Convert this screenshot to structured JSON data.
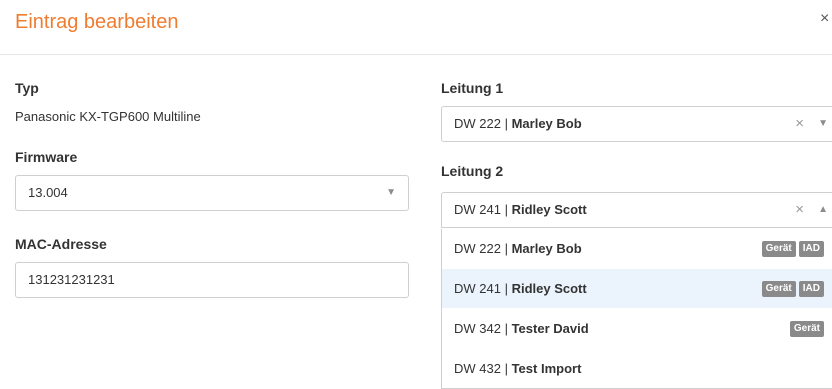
{
  "dialog": {
    "title": "Eintrag bearbeiten",
    "close": "×"
  },
  "left": {
    "typ_label": "Typ",
    "typ_value": "Panasonic KX-TGP600 Multiline",
    "firmware_label": "Firmware",
    "firmware_value": "13.004",
    "mac_label": "MAC-Adresse",
    "mac_value": "131231231231"
  },
  "right": {
    "leitung1_label": "Leitung 1",
    "leitung1": {
      "code": "DW 222",
      "name": "Marley Bob"
    },
    "leitung2_label": "Leitung 2",
    "leitung2": {
      "code": "DW 241",
      "name": "Ridley Scott"
    }
  },
  "dropdown": {
    "options": [
      {
        "code": "DW 222",
        "name": "Marley Bob",
        "badges": [
          "Gerät",
          "IAD"
        ]
      },
      {
        "code": "DW 241",
        "name": "Ridley Scott",
        "badges": [
          "Gerät",
          "IAD"
        ],
        "active": true
      },
      {
        "code": "DW 342",
        "name": "Tester David",
        "badges": [
          "Gerät"
        ]
      },
      {
        "code": "DW 432",
        "name": "Test Import",
        "badges": []
      }
    ]
  },
  "icons": {
    "caret_down": "caret-down-icon",
    "caret_up": "caret-up-icon",
    "clear": "clear-icon"
  },
  "colors": {
    "title": "#ef7d31",
    "highlight": "#ebf4fc",
    "badge": "#8a8a8a"
  }
}
